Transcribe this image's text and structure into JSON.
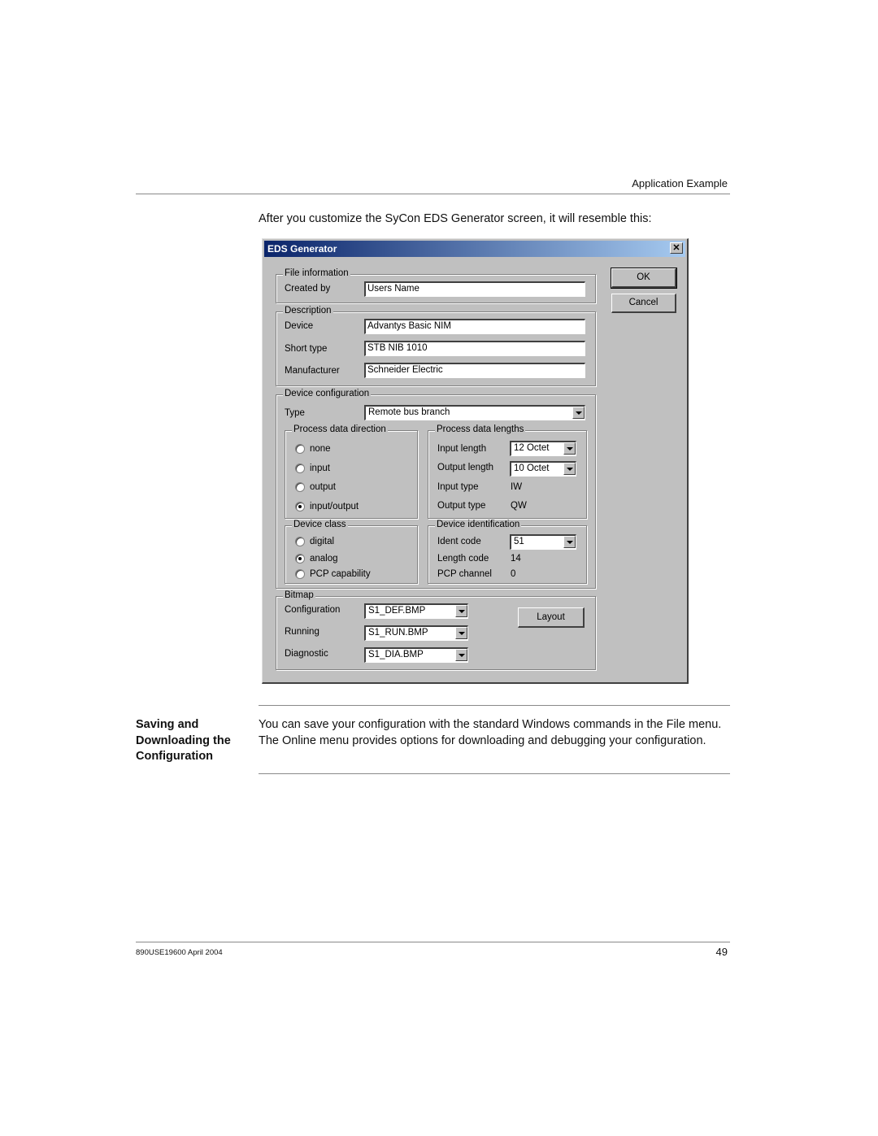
{
  "page": {
    "header_section": "Application Example",
    "intro": "After you customize the SyCon EDS Generator screen, it will resemble this:",
    "side_heading": "Saving and Downloading the Configuration",
    "body": "You can save your configuration with the standard Windows commands in the File menu. The Online menu provides options for downloading and debugging your configuration.",
    "footer_left": "890USE19600 April 2004",
    "page_number": "49"
  },
  "dialog": {
    "title": "EDS Generator",
    "close_glyph": "✕",
    "buttons": {
      "ok": "OK",
      "cancel": "Cancel",
      "layout": "Layout"
    },
    "file_information": {
      "legend": "File information",
      "created_by_label": "Created by",
      "created_by_value": "Users Name"
    },
    "description": {
      "legend": "Description",
      "device_label": "Device",
      "device_value": "Advantys Basic NIM",
      "short_type_label": "Short type",
      "short_type_value": "STB NIB 1010",
      "manufacturer_label": "Manufacturer",
      "manufacturer_value": "Schneider Electric"
    },
    "device_configuration": {
      "legend": "Device configuration",
      "type_label": "Type",
      "type_value": "Remote bus branch",
      "process_data_direction": {
        "legend": "Process data direction",
        "options": [
          "none",
          "input",
          "output",
          "input/output"
        ],
        "selected": "input/output"
      },
      "process_data_lengths": {
        "legend": "Process data lengths",
        "input_length_label": "Input length",
        "input_length_value": "12 Octet",
        "output_length_label": "Output length",
        "output_length_value": "10 Octet",
        "input_type_label": "Input type",
        "input_type_value": "IW",
        "output_type_label": "Output type",
        "output_type_value": "QW"
      },
      "device_class": {
        "legend": "Device class",
        "options": [
          "digital",
          "analog",
          "PCP capability"
        ],
        "selected": "analog"
      },
      "device_identification": {
        "legend": "Device identification",
        "ident_code_label": "Ident code",
        "ident_code_value": "51",
        "length_code_label": "Length code",
        "length_code_value": "14",
        "pcp_channel_label": "PCP channel",
        "pcp_channel_value": "0"
      }
    },
    "bitmap": {
      "legend": "Bitmap",
      "configuration_label": "Configuration",
      "configuration_value": "S1_DEF.BMP",
      "running_label": "Running",
      "running_value": "S1_RUN.BMP",
      "diagnostic_label": "Diagnostic",
      "diagnostic_value": "S1_DIA.BMP"
    }
  }
}
